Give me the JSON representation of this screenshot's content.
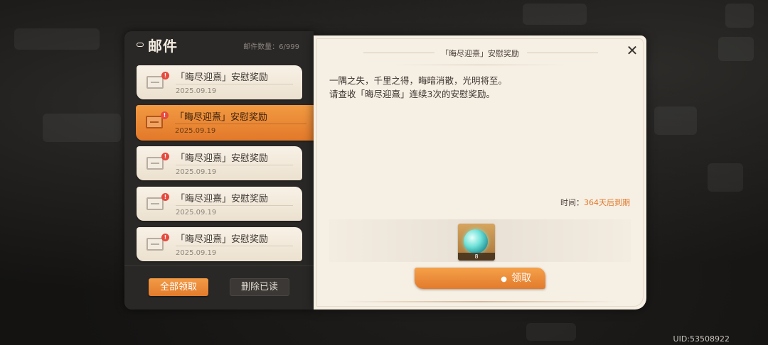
{
  "left_panel": {
    "title": "邮件",
    "mail_count_label": "邮件数量：",
    "mail_count_value": "6/999",
    "items": [
      {
        "title": "「晦尽迎熹」安慰奖励",
        "date": "2025.09.19",
        "badge": "!"
      },
      {
        "title": "「晦尽迎熹」安慰奖励",
        "date": "2025.09.19",
        "badge": "!"
      },
      {
        "title": "「晦尽迎熹」安慰奖励",
        "date": "2025.09.19",
        "badge": "!"
      },
      {
        "title": "「晦尽迎熹」安慰奖励",
        "date": "2025.09.19",
        "badge": "!"
      },
      {
        "title": "「晦尽迎熹」安慰奖励",
        "date": "2025.09.19",
        "badge": "!"
      }
    ],
    "claim_all_label": "全部领取",
    "delete_read_label": "删除已读"
  },
  "detail": {
    "title": "「晦尽迎熹」安慰奖励",
    "close_icon": "close-icon",
    "body_line1": "一隅之失，千里之得，晦暗消散，光明将至。",
    "body_line2": "请查收「晦尽迎熹」连续3次的安慰奖励。",
    "expire_label": "时间：",
    "expire_value": "364天后到期",
    "reward": {
      "icon": "orb-icon",
      "count": "8"
    },
    "claim_label": "领取"
  },
  "uid": "UID:53508922",
  "colors": {
    "accent": "#e27b2c",
    "panel_dark": "#2a2826",
    "panel_light": "#f6efe4",
    "expire": "#e07a2a"
  }
}
